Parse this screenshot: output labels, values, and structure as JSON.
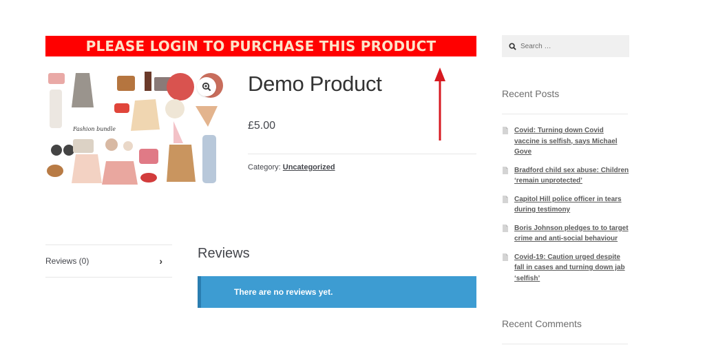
{
  "banner": {
    "text": "PLEASE LOGIN TO PURCHASE THIS PRODUCT"
  },
  "product": {
    "title": "Demo Product",
    "price": "£5.00",
    "category_label": "Category:",
    "category_value": "Uncategorized",
    "image_lettering": "Fashion bundle"
  },
  "tabs": [
    {
      "label": "Reviews (0)"
    }
  ],
  "reviews": {
    "heading": "Reviews",
    "notice": "There are no reviews yet."
  },
  "sidebar": {
    "search_placeholder": "Search …",
    "recent_posts_title": "Recent Posts",
    "recent_posts": [
      "Covid: Turning down Covid vaccine is selfish, says Michael Gove",
      "Bradford child sex abuse: Children ‘remain unprotected’",
      "Capitol Hill police officer in tears during testimony",
      "Boris Johnson pledges to to target crime and anti-social behaviour",
      "Covid-19: Caution urged despite fall in cases and turning down jab ‘selfish’"
    ],
    "recent_comments_title": "Recent Comments"
  },
  "colors": {
    "banner_bg": "#ff0000",
    "banner_text": "#fde3c9",
    "notice_bg": "#3d9cd2",
    "arrow": "#d71920"
  },
  "icons": {
    "zoom": "magnifier-plus-icon",
    "search": "search-icon",
    "tab_chevron": "chevron-right-icon",
    "post": "document-icon"
  }
}
